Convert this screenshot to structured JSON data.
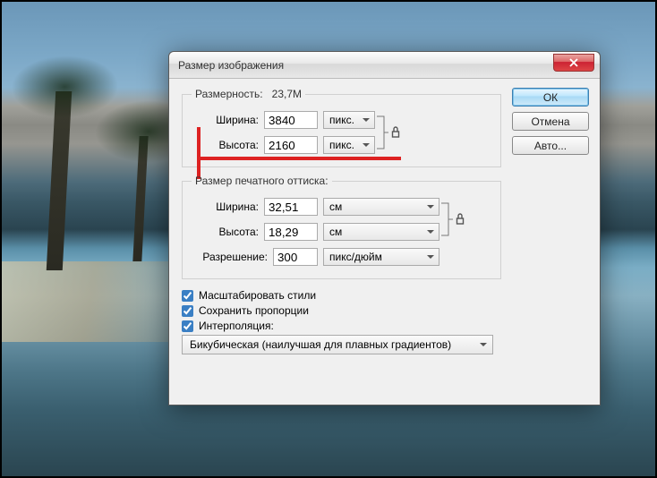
{
  "dialog": {
    "title": "Размер изображения",
    "dimension_legend_prefix": "Размерность:",
    "dimension_value": "23,7M",
    "pixel": {
      "width_label": "Ширина:",
      "width_value": "3840",
      "width_unit": "пикс.",
      "height_label": "Высота:",
      "height_value": "2160",
      "height_unit": "пикс."
    },
    "print_legend": "Размер печатного оттиска:",
    "print": {
      "width_label": "Ширина:",
      "width_value": "32,51",
      "width_unit": "см",
      "height_label": "Высота:",
      "height_value": "18,29",
      "height_unit": "см",
      "res_label": "Разрешение:",
      "res_value": "300",
      "res_unit": "пикс/дюйм"
    },
    "options": {
      "scale_styles": "Масштабировать стили",
      "keep_proportions": "Сохранить пропорции",
      "interpolation_label": "Интерполяция:",
      "interpolation_value": "Бикубическая (наилучшая для плавных градиентов)"
    }
  },
  "buttons": {
    "ok": "ОК",
    "cancel": "Отмена",
    "auto": "Авто..."
  }
}
